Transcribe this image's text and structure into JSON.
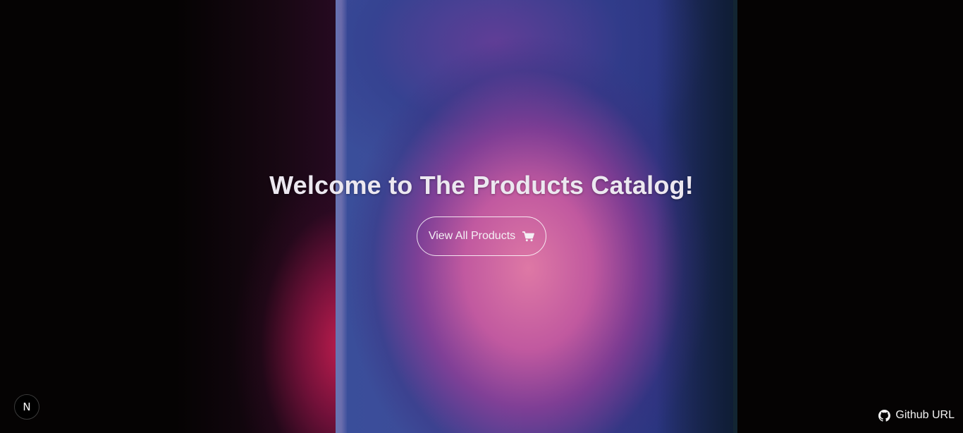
{
  "hero": {
    "title": "Welcome to The Products Catalog!",
    "cta_label": "View All Products",
    "cta_icon": "cart-icon"
  },
  "footer": {
    "github_label": "Github URL",
    "github_icon": "github-icon",
    "dev_badge_letter": "N"
  },
  "colors": {
    "background": "#050303",
    "title_text": "#ece8f0",
    "accent_pink": "#de78a5",
    "accent_blue": "#3a4e9a"
  }
}
